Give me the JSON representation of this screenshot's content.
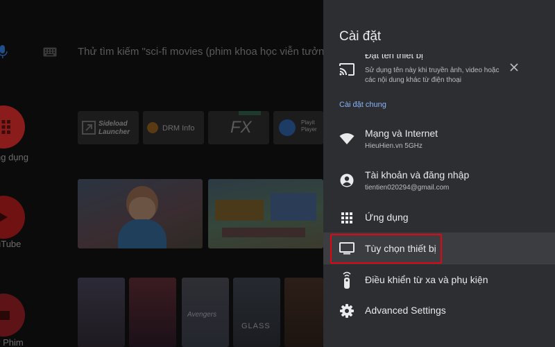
{
  "home": {
    "search_hint": "Thử tìm kiếm \"sci-fi movies (phim khoa học viễn tưởng)\"",
    "apps": [
      {
        "label": "ng dụng",
        "color": "#8a1c1c"
      },
      {
        "label": "uTube",
        "color": "#701212"
      },
      {
        "label": "y Phim",
        "color": "#5e1416"
      }
    ],
    "app_tiles": [
      {
        "label": "Sideload Launcher"
      },
      {
        "label": "DRM Info"
      },
      {
        "label": "FX"
      },
      {
        "label": "Playit Player"
      }
    ],
    "posters": [
      {
        "label": ""
      },
      {
        "label": ""
      },
      {
        "label": "Avengers"
      },
      {
        "label": "GLASS"
      },
      {
        "label": ""
      }
    ]
  },
  "settings": {
    "title": "Cài đặt",
    "cast": {
      "title": "Đặt tên thiết bị",
      "subtitle_line1": "Sử dụng tên này khi truyền ảnh, video hoặc",
      "subtitle_line2": "các nội dung khác từ điện thoại"
    },
    "section_general": "Cài đặt chung",
    "items": [
      {
        "title": "Mạng và Internet",
        "subtitle": "HieuHien.vn 5GHz",
        "icon": "wifi-icon"
      },
      {
        "title": "Tài khoản và đăng nhập",
        "subtitle": "tientien020294@gmail.com",
        "icon": "account-icon"
      },
      {
        "title": "Ứng dụng",
        "icon": "apps-grid-icon"
      },
      {
        "title": "Tùy chọn thiết bị",
        "icon": "tv-icon",
        "highlighted": true
      },
      {
        "title": "Điều khiển từ xa và phụ kiện",
        "icon": "remote-icon"
      },
      {
        "title": "Advanced Settings",
        "icon": "gear-icon"
      }
    ],
    "accent_color": "#8ab4f8",
    "highlight_border_color": "#e30612"
  }
}
